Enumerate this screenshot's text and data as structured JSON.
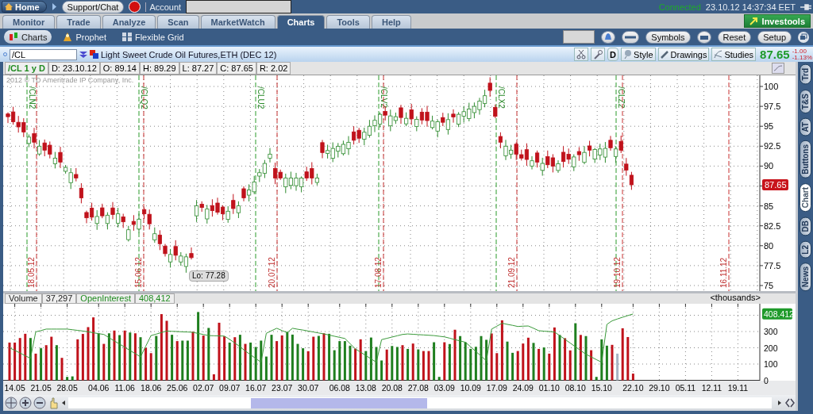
{
  "top_bar": {
    "home": "Home",
    "support": "Support/Chat",
    "account_label": "Account",
    "status": "Connected",
    "clock": "23.10.12 14:37:34 EET"
  },
  "tabs": [
    {
      "label": "Monitor",
      "selected": false
    },
    {
      "label": "Trade",
      "selected": false
    },
    {
      "label": "Analyze",
      "selected": false
    },
    {
      "label": "Scan",
      "selected": false
    },
    {
      "label": "MarketWatch",
      "selected": false
    },
    {
      "label": "Charts",
      "selected": true
    },
    {
      "label": "Tools",
      "selected": false
    },
    {
      "label": "Help",
      "selected": false
    }
  ],
  "brand_button": "Investools",
  "subtabs": [
    {
      "label": "Charts",
      "selected": true
    },
    {
      "label": "Prophet",
      "selected": false
    },
    {
      "label": "Flexible Grid",
      "selected": false
    }
  ],
  "toolbar_buttons": [
    "Symbols",
    "Reset",
    "Setup"
  ],
  "chart_header": {
    "symbol": "/CL",
    "description": "Light Sweet Crude Oil Futures,ETH (DEC 12)",
    "period_button": "D",
    "buttons": [
      "Style",
      "Drawings",
      "Studies"
    ],
    "last_price": "87.65",
    "change": "-1.00",
    "change_percent": "-1.13%"
  },
  "info_bar": {
    "title": "/CL 1 y D",
    "fields": [
      "D: 23.10.12",
      "O: 89.14",
      "H: 89.29",
      "L: 87.27",
      "C: 87.65",
      "R: 2.02"
    ]
  },
  "price_chart": {
    "copyright": "2012 © TD Ameritrade IP Company, Inc.",
    "price_labels": [
      "100",
      "97.5",
      "95",
      "92.5",
      "90",
      "85",
      "82.5",
      "80",
      "77.5",
      "75"
    ],
    "current_price": "87.65",
    "low_label": "Lo: 77.28",
    "contract_markers": [
      "/CLN2",
      "/CLQ2",
      "/CLU2",
      "/CLV2",
      "/CLX2",
      "/CLZ2"
    ],
    "expiry_markers": [
      "18.05.12",
      "15.06.12",
      "20.07.12",
      "17.08.12",
      "21.09.12",
      "19.10.12",
      "16.11.12"
    ]
  },
  "volume_panel": {
    "studies": [
      {
        "value": "37,297",
        "color": "#222222"
      },
      {
        "value": "408,412",
        "color": "#1f8a1f"
      }
    ],
    "units": "<thousands>",
    "oi_badge": "408.412",
    "chart_data": {
      "type": "bar",
      "grid": true,
      "ylim": [
        0,
        470
      ],
      "yticks": [
        0,
        100,
        200,
        300
      ],
      "categories": [
        null,
        "14.05",
        null,
        null,
        null,
        null,
        "21.05",
        null,
        null,
        null,
        null,
        "28.05",
        null,
        null,
        null,
        null,
        null,
        "04.06",
        null,
        null,
        null,
        null,
        "11.06",
        null,
        null,
        null,
        null,
        "18.06",
        null,
        null,
        null,
        null,
        "25.06",
        null,
        null,
        null,
        null,
        "02.07",
        null,
        null,
        null,
        null,
        "09.07",
        null,
        null,
        null,
        null,
        "16.07",
        null,
        null,
        null,
        null,
        "23.07",
        null,
        null,
        null,
        null,
        "30.07",
        null,
        null,
        null,
        null,
        null,
        "06.08",
        null,
        null,
        null,
        null,
        "13.08",
        null,
        null,
        null,
        null,
        "20.08",
        null,
        null,
        null,
        null,
        "27.08",
        null,
        null,
        null,
        null,
        "03.09",
        null,
        null,
        null,
        null,
        "10.09",
        null,
        null,
        null,
        null,
        "17.09",
        null,
        null,
        null,
        null,
        "24.09",
        null,
        null,
        null,
        null,
        "01.10",
        null,
        null,
        null,
        null,
        "08.10",
        null,
        null,
        null,
        null,
        "15.10",
        null,
        null,
        null,
        null,
        null,
        "22.10",
        null,
        null,
        null,
        null,
        "29.10",
        null,
        null,
        null,
        null,
        "05.11",
        null,
        null,
        null,
        null,
        "12.11",
        null,
        null,
        null,
        null,
        "19.11",
        null,
        null,
        null
      ],
      "series": [
        {
          "name": "Volume",
          "color": "#c0121b",
          "values": [
            232,
            232,
            260,
            286,
            null,
            164,
            null,
            216,
            268,
            null,
            138,
            null,
            null,
            252,
            285,
            327,
            387,
            null,
            224,
            null,
            306,
            null,
            306,
            null,
            289,
            null,
            200,
            167,
            null,
            407,
            366,
            null,
            241,
            null,
            null,
            299,
            null,
            275,
            null,
            37,
            354,
            270,
            null,
            265,
            null,
            224,
            null,
            null,
            null,
            null,
            null,
            241,
            276,
            null,
            null,
            null,
            null,
            179,
            268,
            null,
            289,
            null,
            null,
            null,
            null,
            null,
            195,
            252,
            null,
            null,
            null,
            null,
            189,
            null,
            null,
            216,
            null,
            226,
            null,
            180,
            180,
            null,
            null,
            234,
            null,
            311,
            null,
            null,
            null,
            null,
            null,
            null,
            288,
            167,
            369,
            null,
            null,
            180,
            226,
            262,
            null,
            193,
            null,
            164,
            325,
            null,
            259,
            184,
            null,
            279,
            null,
            185,
            null,
            null,
            null,
            218,
            null,
            320,
            266,
            41,
            null,
            null,
            null,
            null,
            null,
            null,
            null,
            null,
            null,
            null,
            null,
            null,
            null,
            null,
            null,
            null,
            null,
            null,
            null,
            null,
            null,
            null,
            null
          ]
        },
        {
          "color": "#1f7f1f",
          "values": [
            null,
            null,
            null,
            null,
            260,
            null,
            197,
            null,
            null,
            216,
            null,
            21,
            24,
            null,
            null,
            null,
            null,
            289,
            null,
            289,
            null,
            278,
            null,
            294,
            null,
            265,
            null,
            null,
            273,
            null,
            null,
            280,
            null,
            244,
            244,
            null,
            420,
            null,
            322,
            null,
            null,
            null,
            232,
            null,
            280,
            null,
            232,
            205,
            244,
            146,
            280,
            null,
            null,
            298,
            281,
            224,
            197,
            null,
            null,
            273,
            null,
            286,
            185,
            241,
            241,
            213,
            null,
            null,
            180,
            263,
            205,
            122,
            null,
            211,
            205,
            null,
            193,
            null,
            190,
            null,
            null,
            234,
            21,
            null,
            223,
            null,
            272,
            234,
            193,
            206,
            272,
            249,
            null,
            null,
            null,
            238,
            169,
            null,
            null,
            null,
            230,
            null,
            202,
            null,
            null,
            279,
            null,
            null,
            351,
            null,
            272,
            null,
            21,
            252,
            213,
            null,
            null,
            null,
            null,
            null,
            null,
            null,
            null,
            null,
            null,
            null,
            null,
            null,
            null,
            null,
            null,
            null,
            null,
            null,
            null,
            null,
            null,
            null,
            null,
            null,
            null,
            null,
            null
          ]
        },
        {
          "color": "#a8b4c4",
          "values": [
            null,
            null,
            null,
            null,
            null,
            null,
            null,
            null,
            null,
            null,
            null,
            null,
            null,
            null,
            null,
            null,
            null,
            null,
            null,
            null,
            null,
            null,
            null,
            null,
            null,
            null,
            null,
            null,
            null,
            null,
            null,
            null,
            null,
            null,
            null,
            null,
            null,
            null,
            null,
            null,
            null,
            null,
            null,
            null,
            null,
            null,
            null,
            null,
            null,
            null,
            null,
            null,
            null,
            null,
            null,
            null,
            null,
            null,
            null,
            null,
            null,
            null,
            null,
            null,
            null,
            null,
            null,
            null,
            null,
            null,
            null,
            null,
            null,
            null,
            null,
            null,
            null,
            null,
            null,
            null,
            null,
            null,
            null,
            null,
            null,
            null,
            null,
            null,
            null,
            null,
            null,
            null,
            null,
            null,
            null,
            null,
            null,
            null,
            null,
            null,
            null,
            null,
            null,
            null,
            null,
            null,
            null,
            null,
            null,
            null,
            null,
            null,
            null,
            null,
            null,
            null,
            164,
            null,
            null,
            null,
            null,
            null,
            null,
            null,
            null,
            null,
            null,
            null,
            null,
            null,
            null,
            null,
            null,
            null,
            null,
            null,
            null,
            null,
            null,
            null,
            null,
            null,
            null
          ]
        },
        {
          "name": "OpenInterest",
          "type": "line",
          "color": "#3a9a3a",
          "values": [
            200,
            184,
            168,
            151,
            135,
            298,
            306,
            315,
            315,
            315,
            315,
            315,
            311,
            307,
            303,
            298,
            292,
            287,
            282,
            262,
            242,
            223,
            203,
            183,
            164,
            144,
            210,
            275,
            284,
            294,
            303,
            301,
            300,
            298,
            297,
            295,
            288,
            282,
            275,
            274,
            273,
            272,
            252,
            229,
            206,
            180,
            157,
            134,
            111,
            289,
            305,
            320,
            306,
            293,
            320,
            314,
            309,
            303,
            297,
            291,
            285,
            278,
            271,
            264,
            257,
            225,
            193,
            173,
            152,
            132,
            111,
            250,
            258,
            266,
            274,
            282,
            285,
            283,
            281,
            279,
            277,
            275,
            271,
            267,
            259,
            250,
            242,
            234,
            206,
            177,
            149,
            120,
            315,
            333,
            351,
            344,
            338,
            331,
            333,
            334,
            320,
            305,
            302,
            300,
            297,
            275,
            252,
            229,
            206,
            183,
            160,
            144,
            127,
            111,
            344,
            366,
            377,
            388,
            398,
            408,
            null,
            null,
            null,
            null,
            null,
            null,
            null,
            null,
            null,
            null,
            null,
            null,
            null,
            null,
            null,
            null,
            null,
            null,
            null,
            null,
            null,
            null,
            null
          ]
        }
      ]
    }
  },
  "side_tabs": [
    {
      "label": "Trd",
      "selected": false
    },
    {
      "label": "T&S",
      "selected": false
    },
    {
      "label": "AT",
      "selected": false
    },
    {
      "label": "Buttons",
      "selected": false
    },
    {
      "label": "Chart",
      "selected": true
    },
    {
      "label": "DB",
      "selected": false
    },
    {
      "label": "L2",
      "selected": false
    },
    {
      "label": "News",
      "selected": false
    }
  ]
}
